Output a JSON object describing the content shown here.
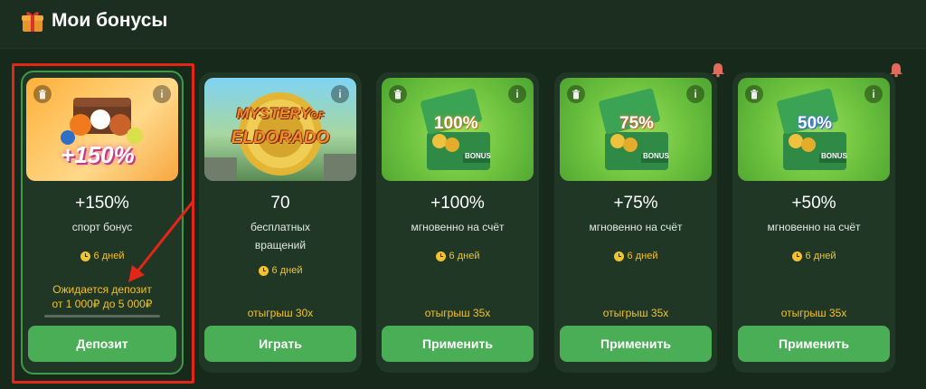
{
  "header": {
    "title": "Мои бонусы",
    "icon": "gift-icon"
  },
  "colors": {
    "accent_green": "#4aae57",
    "highlight_red": "#e42618",
    "gold": "#f2c230",
    "card_bg": "#213726",
    "page_bg": "#17291b"
  },
  "cards": [
    {
      "image_label": "+150%",
      "value": "+150%",
      "subtitle": "спорт бонус",
      "duration": "6 дней",
      "pending_line1": "Ожидается депозит",
      "pending_line2": "от 1 000₽ до 5 000₽",
      "deposit_progress": 0,
      "button": "Депозит",
      "info": "i"
    },
    {
      "image_label_line1": "MYSTERY",
      "image_label_of": "OF",
      "image_label_line2": "ELDORADO",
      "value": "70",
      "subtitle_line1": "бесплатных",
      "subtitle_line2": "вращений",
      "duration": "6 дней",
      "wager": "отыгрыш 30x",
      "button": "Играть",
      "info": "i"
    },
    {
      "image_label": "100%",
      "image_badge": "BONUS",
      "value": "+100%",
      "subtitle": "мгновенно на счёт",
      "duration": "6 дней",
      "wager": "отыгрыш 35x",
      "button": "Применить",
      "info": "i"
    },
    {
      "image_label": "75%",
      "image_badge": "BONUS",
      "value": "+75%",
      "subtitle": "мгновенно на счёт",
      "duration": "6 дней",
      "wager": "отыгрыш 35x",
      "button": "Применить",
      "info": "i",
      "notification": "bell-icon"
    },
    {
      "image_label": "50%",
      "image_badge": "BONUS",
      "value": "+50%",
      "subtitle": "мгновенно на счёт",
      "duration": "6 дней",
      "wager": "отыгрыш 35x",
      "button": "Применить",
      "info": "i",
      "notification": "bell-icon"
    }
  ]
}
